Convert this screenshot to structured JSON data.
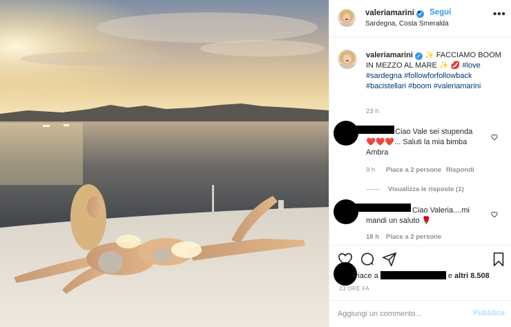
{
  "photo": {
    "icon": "beach-photo"
  },
  "header": {
    "username": "valeriamarini",
    "dot": "•",
    "follow_label": "Segui",
    "location": "Sardegna, Costa Smeralda",
    "more_label": "•••"
  },
  "caption": {
    "username": "valeriamarini",
    "text": "✨ FACCIAMO BOOM IN MEZZO AL MARE ✨ 💋",
    "hashtags": [
      "#love",
      "#sardegna",
      "#followforfollowback",
      "#bacistellari",
      "#boom",
      "#valeriamarini"
    ],
    "time": "23 h"
  },
  "comments": [
    {
      "text_line1": "Ciao Vale sei stupenda",
      "text_line2": "❤️❤️❤️... Saluti la mia bimba",
      "text_line3": "Ambra",
      "time": "9 h",
      "likes": "Piace a 2 persone",
      "reply": "Rispondi",
      "view_replies": "Visualizza le risposte (1)"
    },
    {
      "text_line1": "Ciao Valeria....mi",
      "text_line2": "mandi un saluto 🌹",
      "time": "18 h",
      "likes": "Piace a 2 persone"
    }
  ],
  "likes_bar": {
    "prefix": "Piace a",
    "suffix": "e",
    "others": "altri 8.508",
    "time": "23 ORE FA"
  },
  "add_comment": {
    "placeholder": "Aggiungi un commento...",
    "publish_label": "Pubblica"
  },
  "colors": {
    "link": "#3897f0",
    "hashtag": "#00376b",
    "muted": "#8e8e8e",
    "publish_disabled": "#b2dffc"
  }
}
